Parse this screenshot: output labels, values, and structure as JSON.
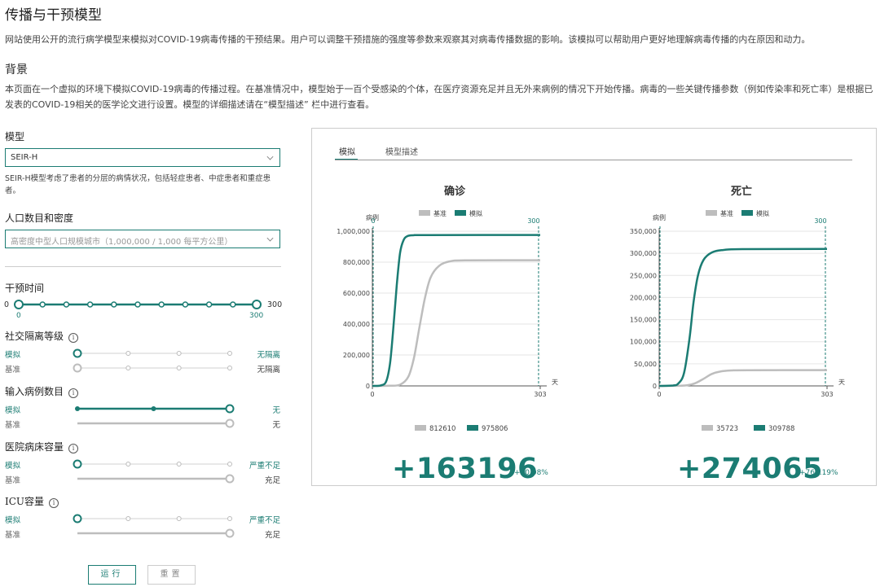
{
  "page": {
    "title": "传播与干预模型",
    "intro": "网站使用公开的流行病学模型来模拟对COVID-19病毒传播的干预结果。用户可以调整干预措施的强度等参数来观察其对病毒传播数据的影响。该模拟可以帮助用户更好地理解病毒传播的内在原因和动力。",
    "background_heading": "背景",
    "background_text": "本页面在一个虚拟的环境下模拟COVID-19病毒的传播过程。在基准情况中，模型始于一百个受感染的个体，在医疗资源充足并且无外来病例的情况下开始传播。病毒的一些关键传播参数（例如传染率和死亡率）是根据已发表的COVID-19相关的医学论文进行设置。模型的详细描述请在“模型描述” 栏中进行查看。"
  },
  "controls": {
    "model_label": "模型",
    "model_value": "SEIR-H",
    "model_desc": "SEIR-H模型考虑了患者的分层的病情状况，包括轻症患者、中症患者和重症患者。",
    "population_label": "人口数目和密度",
    "population_value": "高密度中型人口规模城市（1,000,000 / 1,000 每平方公里）",
    "intervention_time": {
      "label": "干预时间",
      "min": "0",
      "max": "300",
      "start_value": "0",
      "end_value": "300",
      "start_fraction": 0,
      "end_fraction": 1,
      "steps": 11
    },
    "sim_label": "模拟",
    "base_label": "基准",
    "sliders": [
      {
        "label": "社交隔离等级",
        "sim_value": "无隔离",
        "base_value": "无隔离",
        "sim_type": "point",
        "sim_pos": 0,
        "base_type": "point",
        "base_pos": 0
      },
      {
        "label": "输入病例数目",
        "sim_value": "无",
        "base_value": "无",
        "sim_type": "full",
        "sim_pos": 1,
        "base_type": "full",
        "base_pos": 1
      },
      {
        "label": "医院病床容量",
        "sim_value": "严重不足",
        "base_value": "充足",
        "sim_type": "point",
        "sim_pos": 0,
        "base_type": "full",
        "base_pos": 1
      },
      {
        "label": "ICU容量",
        "sim_value": "严重不足",
        "base_value": "充足",
        "sim_type": "point",
        "sim_pos": 0,
        "base_type": "full",
        "base_pos": 1
      }
    ],
    "run_label": "运行",
    "reset_label": "重置"
  },
  "tabs": [
    {
      "label": "模拟",
      "active": true
    },
    {
      "label": "模型描述",
      "active": false
    }
  ],
  "colors": {
    "accent": "#1b7c73",
    "baseline": "#bdbdbd"
  },
  "chart_data": [
    {
      "type": "line",
      "title": "确诊",
      "ylabel": "病例",
      "xlabel": "天",
      "xlim": [
        0,
        303
      ],
      "ylim": [
        0,
        1000000
      ],
      "yticks": [
        0,
        200000,
        400000,
        600000,
        800000,
        1000000
      ],
      "ytick_labels": [
        "0",
        "200,000",
        "400,000",
        "600,000",
        "800,000",
        "1,000,000"
      ],
      "xtick_labels": [
        "0",
        "303"
      ],
      "marker_x": 300,
      "marker_label": "300",
      "start_marker_label": "0",
      "legend": "top",
      "series": [
        {
          "name": "基准",
          "color": "#bdbdbd",
          "final_value": 812610,
          "x": [
            0,
            30,
            50,
            65,
            75,
            85,
            95,
            105,
            120,
            140,
            170,
            303
          ],
          "y": [
            0,
            1000,
            8000,
            60000,
            180000,
            380000,
            570000,
            700000,
            775000,
            805000,
            812000,
            812610
          ]
        },
        {
          "name": "模拟",
          "color": "#1b7c73",
          "final_value": 975806,
          "x": [
            0,
            15,
            25,
            32,
            38,
            44,
            50,
            56,
            63,
            75,
            100,
            303
          ],
          "y": [
            0,
            3000,
            30000,
            150000,
            380000,
            650000,
            860000,
            940000,
            968000,
            974000,
            975500,
            975806
          ]
        }
      ],
      "legend_bottom": [
        {
          "label": "812610",
          "color": "#bdbdbd"
        },
        {
          "label": "975806",
          "color": "#1b7c73"
        }
      ],
      "delta": "+163196",
      "delta_pct": "+20.08%"
    },
    {
      "type": "line",
      "title": "死亡",
      "ylabel": "病例",
      "xlabel": "天",
      "xlim": [
        0,
        303
      ],
      "ylim": [
        0,
        350000
      ],
      "yticks": [
        0,
        50000,
        100000,
        150000,
        200000,
        250000,
        300000,
        350000
      ],
      "ytick_labels": [
        "0",
        "50,000",
        "100,000",
        "150,000",
        "200,000",
        "250,000",
        "300,000",
        "350,000"
      ],
      "xtick_labels": [
        "0",
        "303"
      ],
      "marker_x": 300,
      "marker_label": "300",
      "start_marker_label": "",
      "legend": "top",
      "series": [
        {
          "name": "基准",
          "color": "#bdbdbd",
          "final_value": 35723,
          "x": [
            0,
            30,
            50,
            65,
            80,
            95,
            110,
            130,
            160,
            303
          ],
          "y": [
            0,
            200,
            1500,
            6000,
            16000,
            27000,
            32500,
            35000,
            35600,
            35723
          ]
        },
        {
          "name": "模拟",
          "color": "#1b7c73",
          "final_value": 309788,
          "x": [
            0,
            25,
            35,
            45,
            55,
            62,
            70,
            80,
            95,
            115,
            150,
            303
          ],
          "y": [
            0,
            1000,
            6000,
            30000,
            110000,
            190000,
            250000,
            285000,
            302000,
            307500,
            309500,
            309788
          ]
        }
      ],
      "legend_bottom": [
        {
          "label": "35723",
          "color": "#bdbdbd"
        },
        {
          "label": "309788",
          "color": "#1b7c73"
        }
      ],
      "delta": "+274065",
      "delta_pct": "+767.19%"
    }
  ]
}
